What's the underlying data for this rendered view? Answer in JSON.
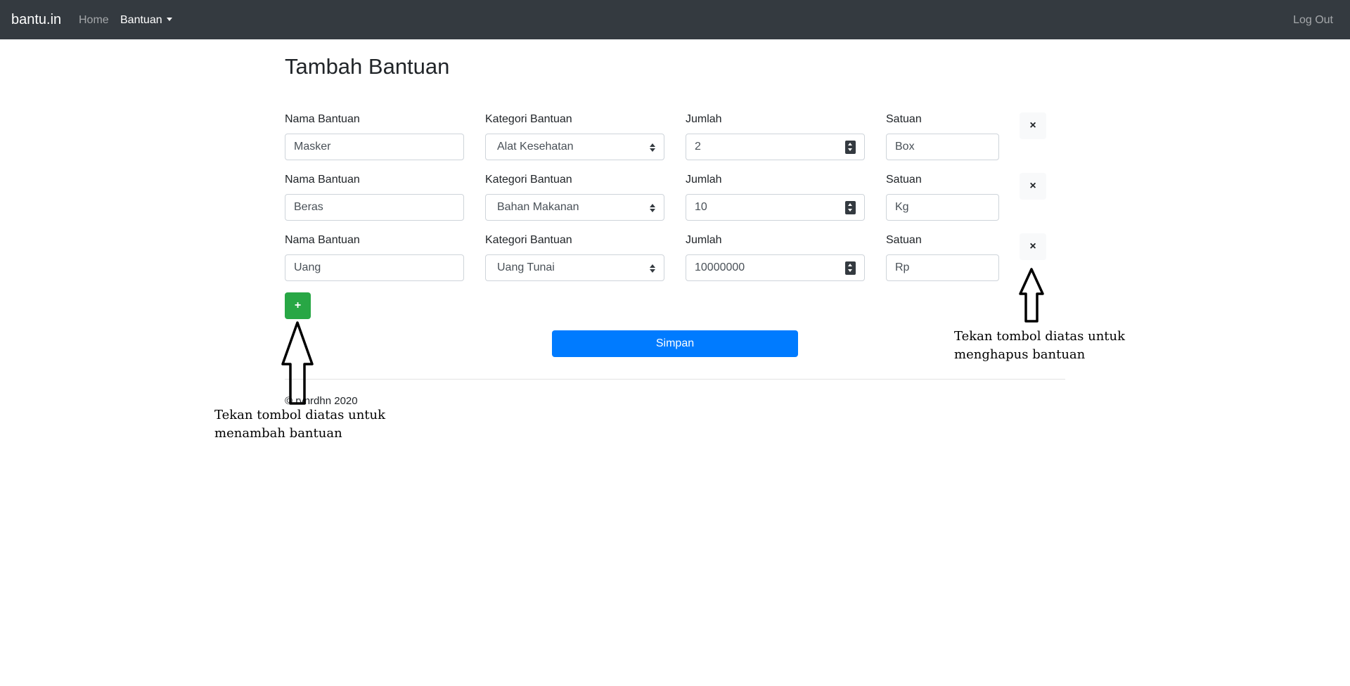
{
  "navbar": {
    "brand": "bantu.in",
    "home_label": "Home",
    "bantuan_label": "Bantuan",
    "logout_label": "Log Out"
  },
  "page": {
    "title": "Tambah Bantuan"
  },
  "form": {
    "labels": {
      "nama": "Nama Bantuan",
      "kategori": "Kategori Bantuan",
      "jumlah": "Jumlah",
      "satuan": "Satuan"
    },
    "rows": [
      {
        "nama": "Masker",
        "kategori": "Alat Kesehatan",
        "jumlah": "2",
        "satuan": "Box"
      },
      {
        "nama": "Beras",
        "kategori": "Bahan Makanan",
        "jumlah": "10",
        "satuan": "Kg"
      },
      {
        "nama": "Uang",
        "kategori": "Uang Tunai",
        "jumlah": "10000000",
        "satuan": "Rp"
      }
    ],
    "remove_label": "×",
    "add_label": "+",
    "save_label": "Simpan"
  },
  "footer": {
    "text": "© rvnrdhn 2020"
  },
  "annotations": {
    "add_line1": "Tekan tombol diatas untuk",
    "add_line2": "menambah bantuan",
    "remove_line1": "Tekan tombol diatas untuk",
    "remove_line2": "menghapus bantuan"
  },
  "colors": {
    "navbar": "#343a40",
    "primary": "#007bff",
    "success": "#28a745",
    "light": "#f8f9fa"
  }
}
